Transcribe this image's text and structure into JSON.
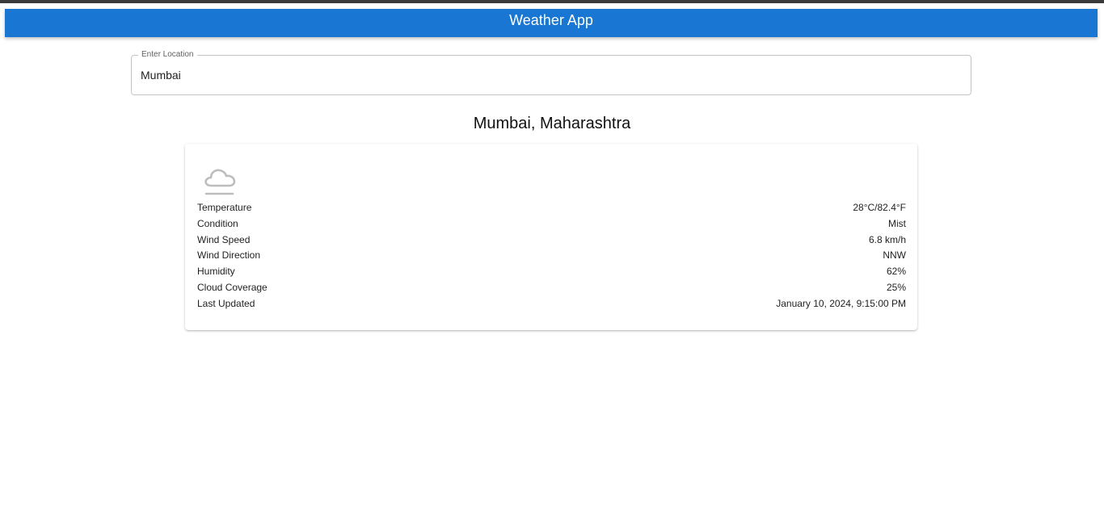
{
  "app": {
    "title": "Weather App",
    "accent_color": "#1976d2"
  },
  "search": {
    "label": "Enter Location",
    "value": "Mumbai"
  },
  "location": {
    "title": "Mumbai, Maharashtra"
  },
  "weather": {
    "icon": "cloud-mist-icon",
    "rows": [
      {
        "label": "Temperature",
        "value": "28°C/82.4°F"
      },
      {
        "label": "Condition",
        "value": "Mist"
      },
      {
        "label": "Wind Speed",
        "value": "6.8 km/h"
      },
      {
        "label": "Wind Direction",
        "value": "NNW"
      },
      {
        "label": "Humidity",
        "value": "62%"
      },
      {
        "label": "Cloud Coverage",
        "value": "25%"
      },
      {
        "label": "Last Updated",
        "value": "January 10, 2024, 9:15:00 PM"
      }
    ]
  }
}
